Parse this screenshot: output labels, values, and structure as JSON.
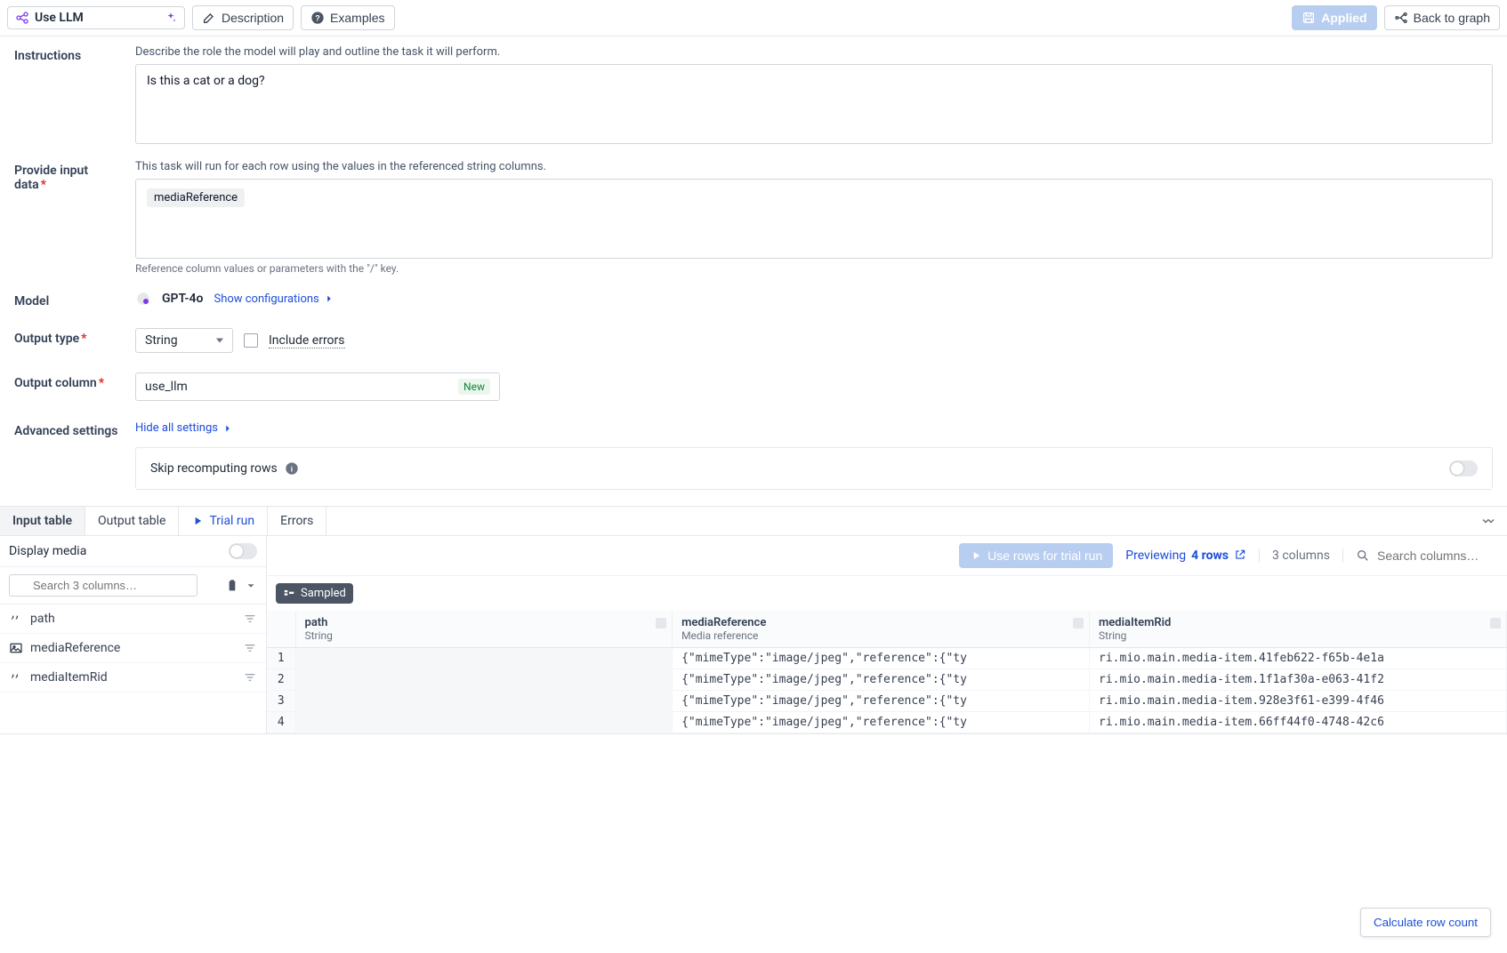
{
  "topbar": {
    "title": "Use LLM",
    "description_btn": "Description",
    "examples_btn": "Examples",
    "applied_btn": "Applied",
    "back_btn": "Back to graph"
  },
  "instructions": {
    "label": "Instructions",
    "helper": "Describe the role the model will play and outline the task it will perform.",
    "value": "Is this a cat or a dog?"
  },
  "input_data": {
    "label": "Provide input data",
    "helper": "This task will run for each row using the values in the referenced string columns.",
    "chip": "mediaReference",
    "subhelper": "Reference column values or parameters with the \"/\" key."
  },
  "model": {
    "label": "Model",
    "name": "GPT-4o",
    "show_config": "Show configurations"
  },
  "output_type": {
    "label": "Output type",
    "value": "String",
    "include_errors": "Include errors"
  },
  "output_column": {
    "label": "Output column",
    "value": "use_llm",
    "new_badge": "New"
  },
  "advanced": {
    "label": "Advanced settings",
    "hide_link": "Hide all settings",
    "skip_label": "Skip recomputing rows"
  },
  "tabs": {
    "input": "Input table",
    "output": "Output table",
    "trial": "Trial run",
    "errors": "Errors"
  },
  "left_panel": {
    "display_media": "Display media",
    "search_placeholder": "Search 3 columns…",
    "columns": [
      {
        "name": "path",
        "kind": "string"
      },
      {
        "name": "mediaReference",
        "kind": "media"
      },
      {
        "name": "mediaItemRid",
        "kind": "string"
      }
    ]
  },
  "toolbar2": {
    "trial_btn": "Use rows for trial run",
    "preview_label": "Previewing",
    "preview_count": "4 rows",
    "col_count": "3 columns",
    "search_placeholder": "Search columns…"
  },
  "sampled_badge": "Sampled",
  "table": {
    "headers": [
      {
        "name": "path",
        "type": "String"
      },
      {
        "name": "mediaReference",
        "type": "Media reference"
      },
      {
        "name": "mediaItemRid",
        "type": "String"
      }
    ],
    "rows": [
      {
        "n": "1",
        "path": "",
        "mediaReference": "{\"mimeType\":\"image/jpeg\",\"reference\":{\"ty",
        "mediaItemRid": "ri.mio.main.media-item.41feb622-f65b-4e1a"
      },
      {
        "n": "2",
        "path": "",
        "mediaReference": "{\"mimeType\":\"image/jpeg\",\"reference\":{\"ty",
        "mediaItemRid": "ri.mio.main.media-item.1f1af30a-e063-41f2"
      },
      {
        "n": "3",
        "path": "",
        "mediaReference": "{\"mimeType\":\"image/jpeg\",\"reference\":{\"ty",
        "mediaItemRid": "ri.mio.main.media-item.928e3f61-e399-4f46"
      },
      {
        "n": "4",
        "path": "",
        "mediaReference": "{\"mimeType\":\"image/jpeg\",\"reference\":{\"ty",
        "mediaItemRid": "ri.mio.main.media-item.66ff44f0-4748-42c6"
      }
    ]
  },
  "calc_btn": "Calculate row count"
}
